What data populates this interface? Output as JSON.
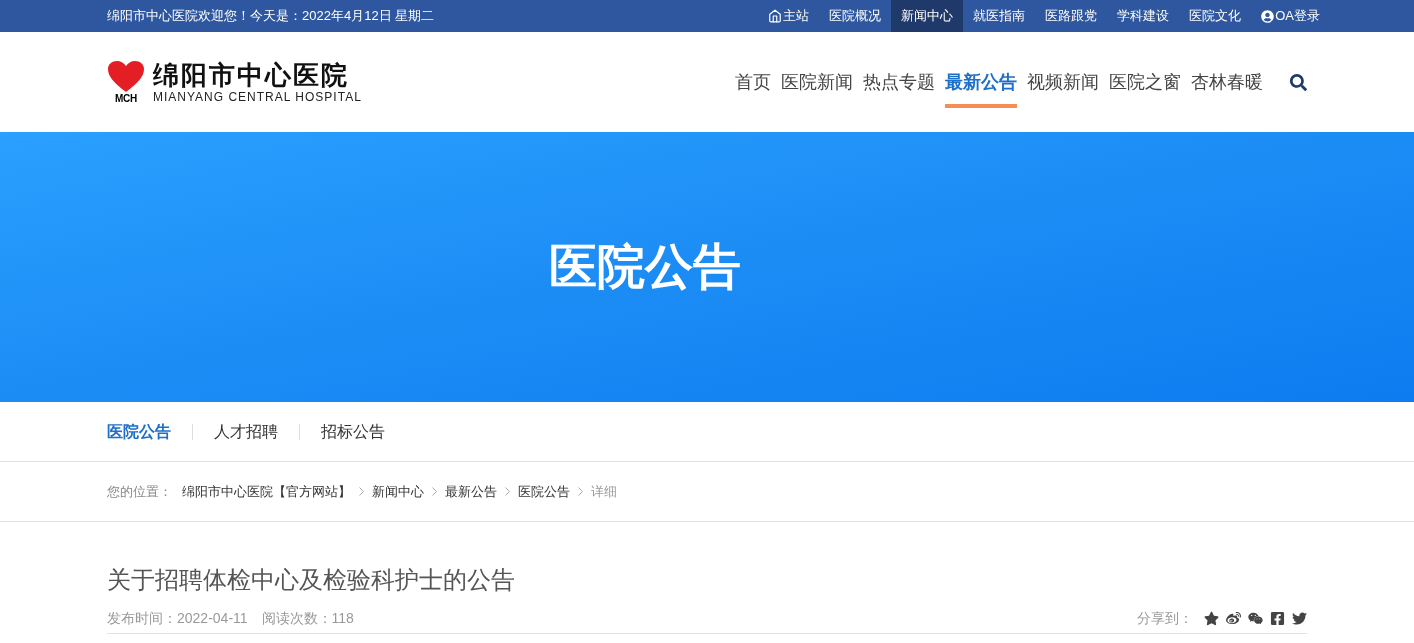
{
  "top_bar": {
    "welcome": "绵阳市中心医院欢迎您！今天是：2022年4月12日 星期二",
    "links": [
      {
        "label": "主站",
        "kind": "home",
        "selected": false
      },
      {
        "label": "医院概况",
        "kind": "plain",
        "selected": false
      },
      {
        "label": "新闻中心",
        "kind": "plain",
        "selected": true
      },
      {
        "label": "就医指南",
        "kind": "plain",
        "selected": false
      },
      {
        "label": "医路跟党",
        "kind": "plain",
        "selected": false
      },
      {
        "label": "学科建设",
        "kind": "plain",
        "selected": false
      },
      {
        "label": "医院文化",
        "kind": "plain",
        "selected": false
      },
      {
        "label": "OA登录",
        "kind": "user",
        "selected": false
      }
    ]
  },
  "logo": {
    "mark": "MCH",
    "name": "绵阳市中心医院",
    "english": "MIANYANG CENTRAL HOSPITAL"
  },
  "main_nav": [
    {
      "label": "首页",
      "selected": false
    },
    {
      "label": "医院新闻",
      "selected": false
    },
    {
      "label": "热点专题",
      "selected": false
    },
    {
      "label": "最新公告",
      "selected": true
    },
    {
      "label": "视频新闻",
      "selected": false
    },
    {
      "label": "医院之窗",
      "selected": false
    },
    {
      "label": "杏林春暖",
      "selected": false
    }
  ],
  "banner": {
    "title": "医院公告"
  },
  "sub_nav": [
    {
      "label": "医院公告",
      "selected": true
    },
    {
      "label": "人才招聘",
      "selected": false
    },
    {
      "label": "招标公告",
      "selected": false
    }
  ],
  "breadcrumb": {
    "label": "您的位置：",
    "items": [
      {
        "label": "绵阳市中心医院【官方网站】",
        "kind": "link"
      },
      {
        "label": "新闻中心",
        "kind": "link"
      },
      {
        "label": "最新公告",
        "kind": "link"
      },
      {
        "label": "医院公告",
        "kind": "link"
      },
      {
        "label": "详细",
        "kind": "current"
      }
    ]
  },
  "article": {
    "title": "关于招聘体检中心及检验科护士的公告",
    "published": "发布时间：2022-04-11",
    "reads": "阅读次数：118",
    "share_label": "分享到：",
    "share": [
      {
        "kind": "star"
      },
      {
        "kind": "weibo"
      },
      {
        "kind": "wechat"
      },
      {
        "kind": "facebook"
      },
      {
        "kind": "twitter"
      }
    ]
  }
}
